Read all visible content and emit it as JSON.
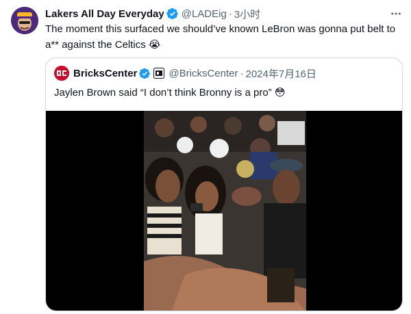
{
  "tweet": {
    "display_name": "Lakers All Day Everyday",
    "handle": "@LADEig",
    "separator": "·",
    "time": "3小时",
    "text": "The moment this surfaced we should’ve known LeBron was gonna put belt to a** against the Celtics",
    "text_emoji": "😭",
    "avatar_icon": "user-avatar-icon",
    "verified_color": "#1d9bf0"
  },
  "quote": {
    "display_name": "BricksCenter",
    "handle": "@BricksCenter",
    "separator": "·",
    "time": "2024年7月16日",
    "text": "Jaylen Brown said “I don’t think Bronny is a pro”",
    "text_emoji": "😳",
    "avatar_icon": "bricks-center-logo-icon",
    "brand_color": "#c8102e"
  },
  "media": {
    "type": "video-thumbnail",
    "icon": "video-still-icon"
  },
  "colors": {
    "text": "#0f1419",
    "secondary": "#536471",
    "border": "#cfd9de",
    "accent": "#1d9bf0"
  }
}
